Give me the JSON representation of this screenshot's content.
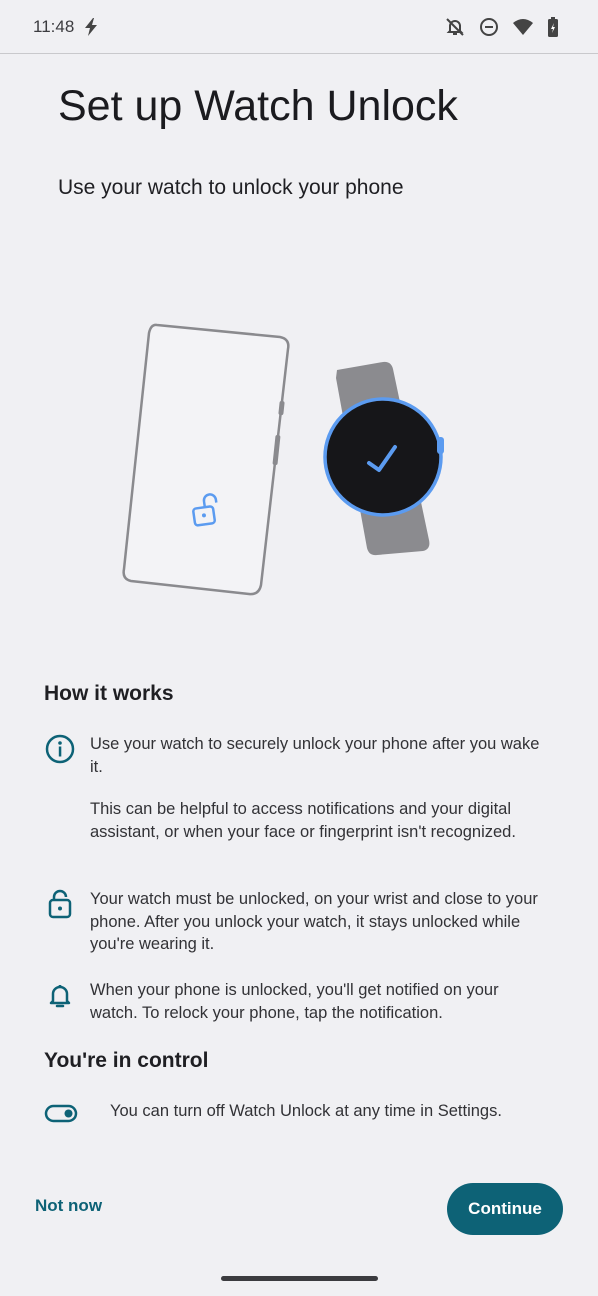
{
  "status_bar": {
    "time": "11:48",
    "icons": [
      "charging-bolt-icon",
      "notifications-off-icon",
      "do-not-disturb-icon",
      "wifi-icon",
      "battery-icon"
    ]
  },
  "page": {
    "title": "Set up Watch Unlock",
    "subtitle": "Use your watch to unlock your phone"
  },
  "how_it_works": {
    "heading": "How it works",
    "items": [
      {
        "icon": "info-icon",
        "text1": "Use your watch to securely unlock your phone after you wake it.",
        "text2": "This can be helpful to access notifications and your digital assistant, or when your face or fingerprint isn't recognized."
      },
      {
        "icon": "lock-icon",
        "text1": "Your watch must be unlocked, on your wrist and close to your phone. After you unlock your watch, it stays unlocked while you're wearing it."
      },
      {
        "icon": "bell-icon",
        "text1": "When your phone is unlocked, you'll get notified on your watch. To relock your phone, tap the notification."
      }
    ]
  },
  "control": {
    "heading": "You're in control",
    "text": "You can turn off Watch Unlock at any time in Settings.",
    "icon": "toggle-icon"
  },
  "actions": {
    "not_now": "Not now",
    "continue": "Continue"
  },
  "colors": {
    "accent": "#0d6276",
    "background": "#f0f0f3",
    "illustration_blue": "#5b9bf0"
  }
}
